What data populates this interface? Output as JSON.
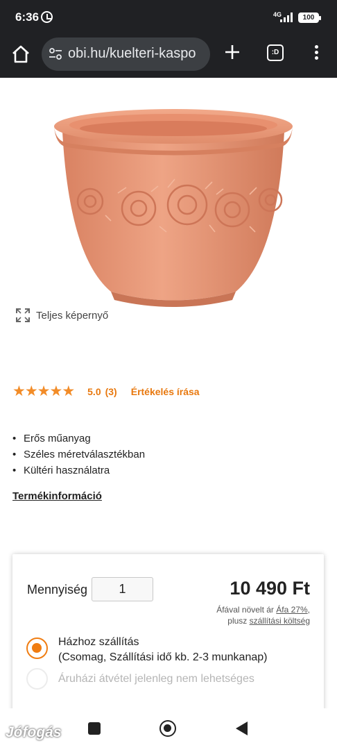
{
  "status_bar": {
    "time": "6:36",
    "network": "4G",
    "battery": "100"
  },
  "browser": {
    "url": "obi.hu/kuelteri-kaspo",
    "tabs_label": ":D"
  },
  "product": {
    "fullscreen_label": "Teljes képernyő",
    "rating": {
      "stars": 5,
      "score": "5.0",
      "count": "(3)",
      "write_review": "Értékelés írása"
    },
    "features": [
      "Erős műanyag",
      "Széles méretválasztékban",
      "Kültéri használatra"
    ],
    "info_link": "Termékinformáció"
  },
  "purchase": {
    "quantity_label": "Mennyiség",
    "quantity_value": "1",
    "price": "10 490 Ft",
    "vat_prefix": "Áfával növelt ár",
    "vat_link": "Áfa 27%",
    "vat_suffix": ",",
    "shipping_prefix": "plusz",
    "shipping_link": "szállítási költség",
    "home_delivery_title": "Házhoz szállítás",
    "home_delivery_detail": "(Csomag, Szállítási idő kb. 2-3 munkanap)",
    "store_pickup": "Áruházi átvétel jelenleg nem lehetséges"
  },
  "watermark": "Jófogás",
  "colors": {
    "accent": "#f07d12",
    "star": "#f28c28",
    "terracotta": "#e09070",
    "browser_bg": "#202124"
  }
}
